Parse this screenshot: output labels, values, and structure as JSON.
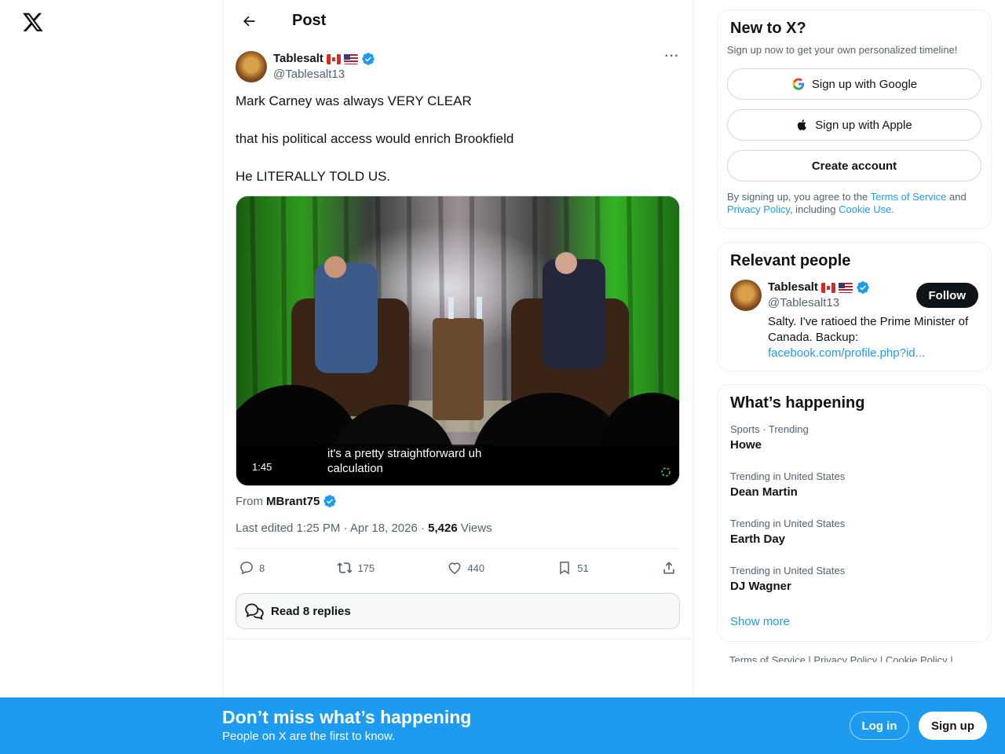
{
  "nav": {
    "logo": "x-logo-icon"
  },
  "header": {
    "title": "Post"
  },
  "post": {
    "author_name": "Tablesalt",
    "author_handle": "@Tablesalt13",
    "paragraphs": [
      "Mark Carney was always VERY CLEAR",
      "that his political access would enrich Brookfield",
      "He LITERALLY TOLD US."
    ],
    "video": {
      "duration": "1:45",
      "caption": "it's a pretty straightforward uh calculation"
    },
    "from_label": "From",
    "from_name": "MBrant75",
    "meta_prefix": "Last edited 1:25 PM · Apr 18, 2026 · ",
    "views_count": "5,426",
    "views_label": " Views",
    "actions": {
      "replies": "8",
      "reposts": "175",
      "likes": "440",
      "bookmarks": "51"
    },
    "read_replies": "Read 8 replies"
  },
  "signup_card": {
    "title": "New to X?",
    "subtitle": "Sign up now to get your own personalized timeline!",
    "google": "Sign up with Google",
    "apple": "Sign up with Apple",
    "create": "Create account",
    "legal_1": "By signing up, you agree to the ",
    "terms": "Terms of Service",
    "legal_2": " and ",
    "privacy": "Privacy Policy",
    "legal_3": ", including ",
    "cookie": "Cookie Use."
  },
  "relevant": {
    "title": "Relevant people",
    "name": "Tablesalt",
    "handle": "@Tablesalt13",
    "follow": "Follow",
    "bio": "Salty. I've ratioed the Prime Minister of Canada. Backup:",
    "bio_link": "facebook.com/profile.php?id..."
  },
  "happening": {
    "title": "What’s happening",
    "trends": [
      {
        "meta": "Sports · Trending",
        "name": "Howe"
      },
      {
        "meta": "Trending in United States",
        "name": "Dean Martin"
      },
      {
        "meta": "Trending in United States",
        "name": "Earth Day"
      },
      {
        "meta": "Trending in United States",
        "name": "DJ Wagner"
      }
    ],
    "show_more": "Show more"
  },
  "footer": {
    "links": "Terms of Service  |  Privacy Policy  |  Cookie Policy  |"
  },
  "bottom_bar": {
    "title": "Don’t miss what’s happening",
    "subtitle": "People on X are the first to know.",
    "login": "Log in",
    "signup": "Sign up"
  },
  "colors": {
    "accent": "#1d9bf0",
    "text": "#0f1419",
    "muted": "#536471"
  }
}
